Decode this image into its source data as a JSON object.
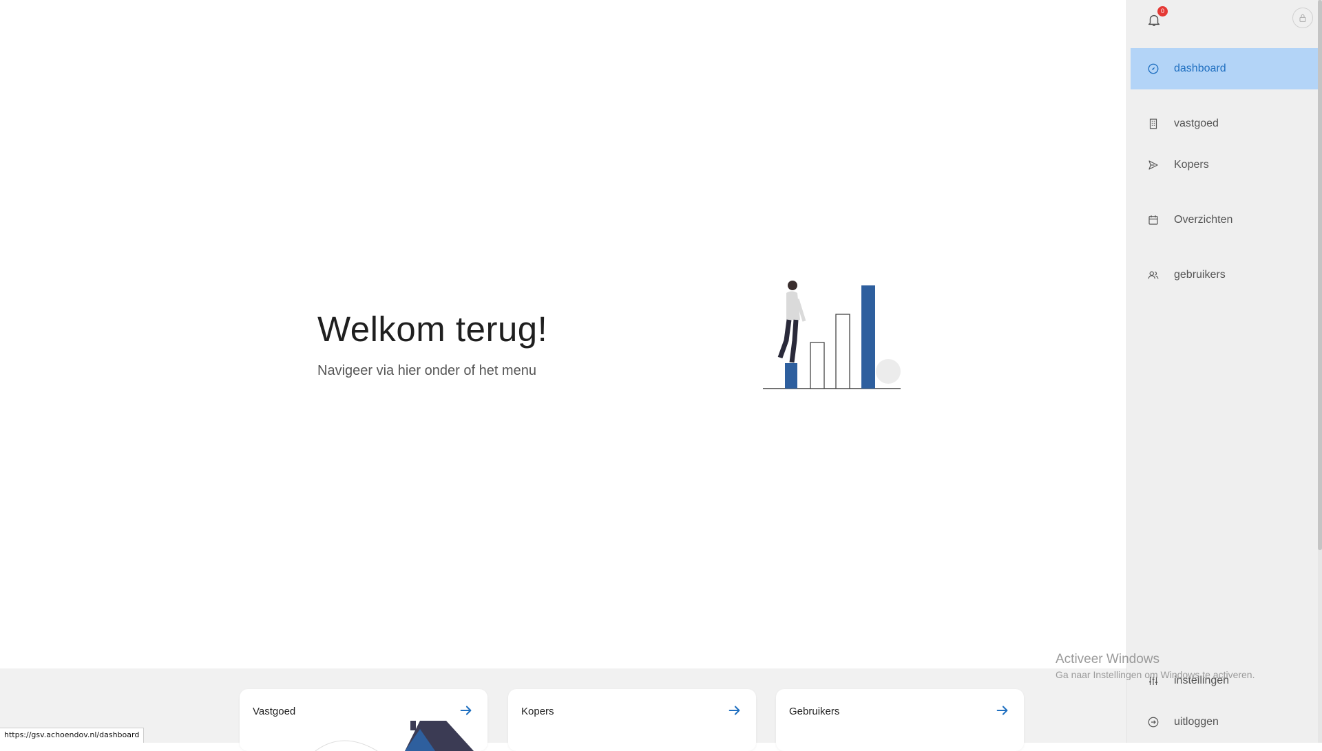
{
  "hero": {
    "title": "Welkom terug!",
    "subtitle": "Navigeer via hier onder of het menu"
  },
  "cards": [
    {
      "label": "Vastgoed",
      "icon": "arrow-right-icon"
    },
    {
      "label": "Kopers",
      "icon": "arrow-right-icon"
    },
    {
      "label": "Gebruikers",
      "icon": "arrow-right-icon"
    }
  ],
  "status_bar": {
    "url": "https://gsv.achoendov.nl/dashboard"
  },
  "sidebar": {
    "notifications": {
      "icon": "bell-icon",
      "count": "0"
    },
    "lock_icon": "lock-icon",
    "items": [
      {
        "label": "dashboard",
        "icon": "compass-icon",
        "active": true
      },
      {
        "label": "vastgoed",
        "icon": "building-icon",
        "active": false
      },
      {
        "label": "Kopers",
        "icon": "send-icon",
        "active": false
      },
      {
        "label": "Overzichten",
        "icon": "calendar-icon",
        "active": false
      },
      {
        "label": "gebruikers",
        "icon": "users-icon",
        "active": false
      }
    ],
    "bottom_items": [
      {
        "label": "instellingen",
        "icon": "sliders-icon"
      },
      {
        "label": "uitloggen",
        "icon": "logout-icon"
      }
    ]
  },
  "watermark": {
    "line1": "Activeer Windows",
    "line2": "Ga naar Instellingen om Windows te activeren."
  },
  "colors": {
    "accent": "#1f6fc0",
    "active_bg": "#b3d4f7",
    "illustration_blue": "#2e5f9e",
    "badge": "#e53935"
  }
}
